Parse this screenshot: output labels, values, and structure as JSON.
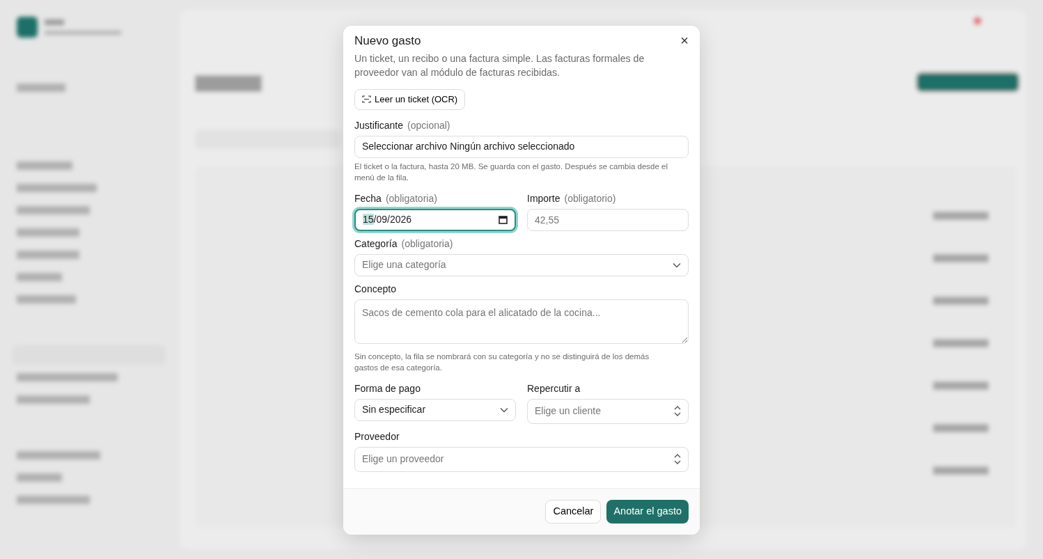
{
  "dialog": {
    "title": "Nuevo gasto",
    "description": "Un ticket, un recibo o una factura simple. Las facturas formales de proveedor van al módulo de facturas recibidas.",
    "close": "×",
    "ocr_button": "Leer un ticket (OCR)",
    "fields": [
      {
        "kind": "file",
        "label": "Justificante",
        "note": "(opcional)",
        "button_label": "Seleccionar archivo",
        "status": "Ningún archivo seleccionado",
        "help": "El ticket o la factura, hasta 20 MB. Se guarda con el gasto. Después se cambia desde el menú de la fila.",
        "half": false
      },
      {
        "kind": "date",
        "label": "Fecha",
        "note": "(obligatoria)",
        "value": "15/09/2026",
        "focused": true,
        "half": true
      },
      {
        "kind": "text",
        "label": "Importe",
        "note": "(obligatorio)",
        "placeholder": "42,55",
        "focused": false,
        "half": true
      },
      {
        "kind": "select",
        "label": "Categoría",
        "note": "(obligatoria)",
        "placeholder": "Elige una categoría",
        "half": false
      },
      {
        "kind": "textarea",
        "label": "Concepto",
        "placeholder": "Sacos de cemento cola para el alicatado de la cocina...",
        "help": "Sin concepto, la fila se nombrará con su categoría y no se distinguirá de los demás gastos de esa categoría.",
        "half": false
      },
      {
        "kind": "select",
        "label": "Forma de pago",
        "value": "Sin especificar",
        "half": true
      },
      {
        "kind": "combobox",
        "label": "Repercutir a",
        "placeholder": "Elige un cliente",
        "half": true
      },
      {
        "kind": "combobox",
        "label": "Proveedor",
        "placeholder": "Elige un proveedor",
        "half": false
      }
    ],
    "buttons": [
      {
        "label": "Cancelar",
        "kind": "secondary"
      },
      {
        "label": "Anotar el gasto",
        "kind": "primary"
      }
    ]
  }
}
